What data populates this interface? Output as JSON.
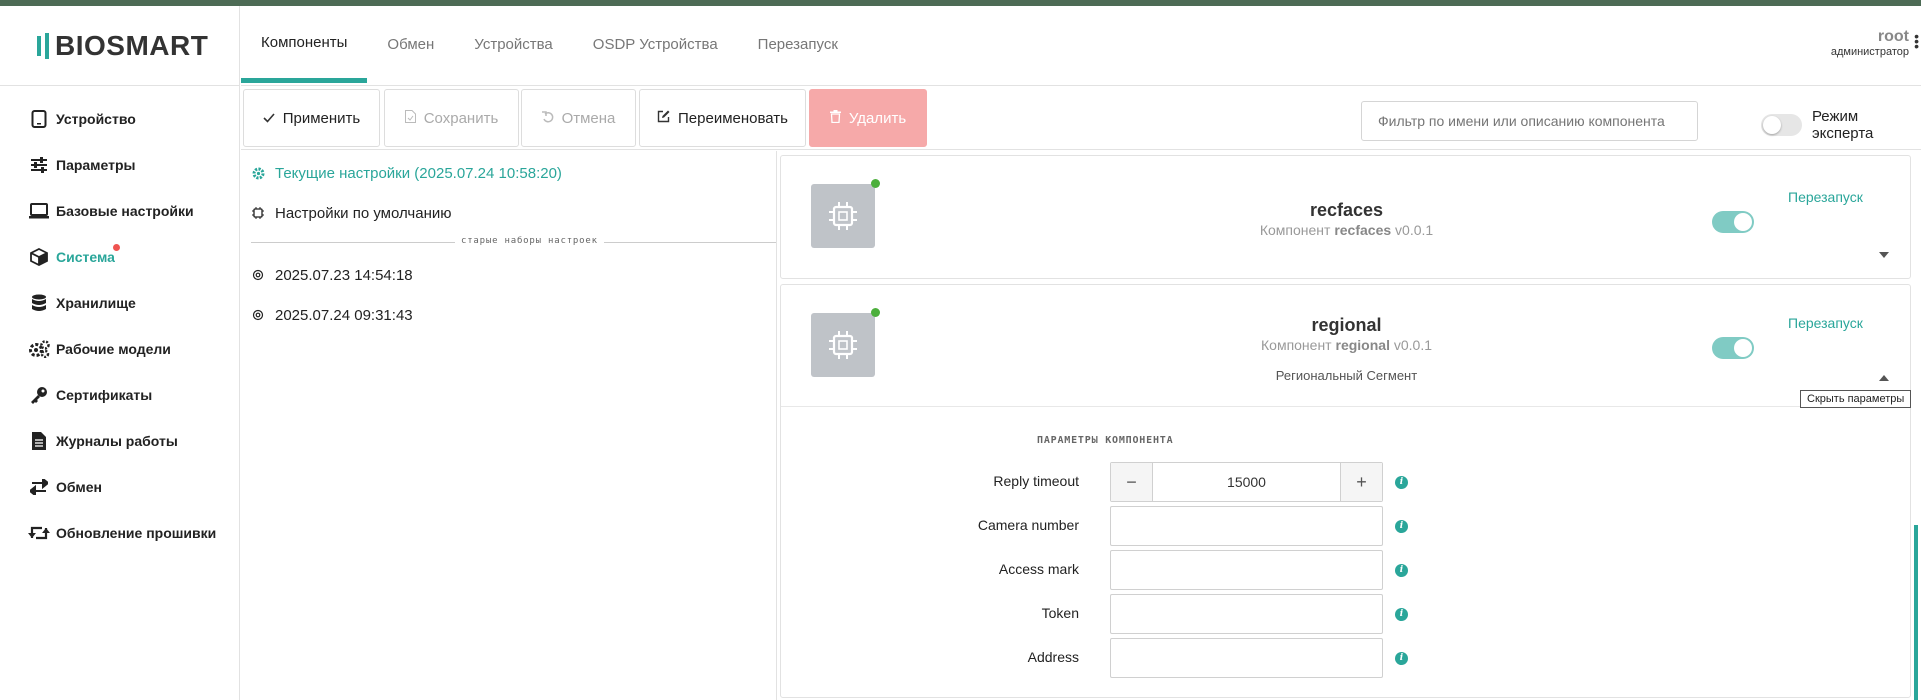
{
  "brand": {
    "logo_text": "BIOSMART",
    "accent": "#2aa69a",
    "danger": "#f6a9a9",
    "topline": "#4d6b55"
  },
  "sidebar": {
    "items": [
      {
        "label": "Устройство",
        "icon": "tablet-icon"
      },
      {
        "label": "Параметры",
        "icon": "sliders-icon"
      },
      {
        "label": "Базовые настройки",
        "icon": "laptop-icon"
      },
      {
        "label": "Система",
        "icon": "cube-icon",
        "active": true,
        "badge": true
      },
      {
        "label": "Хранилище",
        "icon": "database-icon"
      },
      {
        "label": "Рабочие модели",
        "icon": "cogs-icon"
      },
      {
        "label": "Сертификаты",
        "icon": "key-icon"
      },
      {
        "label": "Журналы работы",
        "icon": "file-icon"
      },
      {
        "label": "Обмен",
        "icon": "exchange-icon"
      },
      {
        "label": "Обновление прошивки",
        "icon": "retweet-icon"
      }
    ]
  },
  "tabs": [
    "Компоненты",
    "Обмен",
    "Устройства",
    "OSDP Устройства",
    "Перезапуск"
  ],
  "user": {
    "name": "root",
    "role": "администратор"
  },
  "toolbar": {
    "apply": "Применить",
    "save": "Сохранить",
    "cancel": "Отмена",
    "rename": "Переименовать",
    "delete": "Удалить",
    "filter_placeholder": "Фильтр по имени или описанию компонента",
    "expert_mode": "Режим эксперта"
  },
  "configs": {
    "current": "Текущие настройки (2025.07.24 10:58:20)",
    "default": "Настройки по умолчанию",
    "old_separator": "старые наборы настроек",
    "old": [
      "2025.07.23 14:54:18",
      "2025.07.24 09:31:43"
    ]
  },
  "components": [
    {
      "name": "recfaces",
      "subtitle_prefix": "Компонент",
      "subtitle_version": "v0.0.1",
      "restart": "Перезапуск",
      "enabled": true
    },
    {
      "name": "regional",
      "subtitle_prefix": "Компонент",
      "subtitle_version": "v0.0.1",
      "description": "Региональный Сегмент",
      "restart": "Перезапуск",
      "enabled": true,
      "tooltip": "Скрыть параметры"
    }
  ],
  "params": {
    "header": "ПАРАМЕТРЫ КОМПОНЕНТА",
    "reply_timeout": {
      "label": "Reply timeout",
      "value": "15000"
    },
    "camera_number": {
      "label": "Camera number",
      "value": ""
    },
    "access_mark": {
      "label": "Access mark",
      "value": ""
    },
    "token": {
      "label": "Token",
      "value": ""
    },
    "address": {
      "label": "Address",
      "value": ""
    }
  }
}
